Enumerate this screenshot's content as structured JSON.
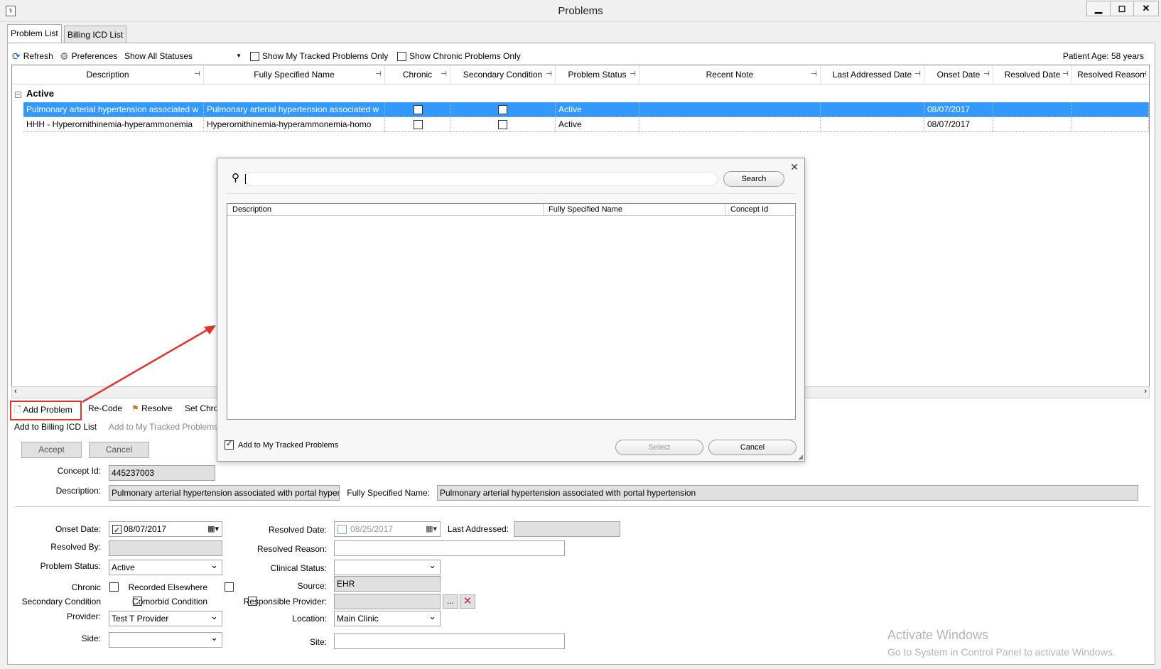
{
  "window": {
    "title": "Problems",
    "minimize": "▁",
    "maximize": "◻",
    "close": "✕"
  },
  "tabs": [
    {
      "label": "Problem List",
      "active": true
    },
    {
      "label": "Billing ICD List",
      "active": false
    }
  ],
  "toolbar": {
    "refresh": "Refresh",
    "preferences": "Preferences",
    "status_filter": "Show All Statuses",
    "tracked_only": "Show My Tracked Problems Only",
    "chronic_only": "Show Chronic Problems Only",
    "patient_age": "Patient Age: 58 years"
  },
  "grid": {
    "columns": [
      "Description",
      "Fully Specified Name",
      "Chronic",
      "Secondary Condition",
      "Problem Status",
      "Recent Note",
      "Last Addressed Date",
      "Onset Date",
      "Resolved Date",
      "Resolved Reason"
    ],
    "group": "Active",
    "rows": [
      {
        "description": "Pulmonary arterial hypertension associated w",
        "fsn": "Pulmonary arterial hypertension associated w",
        "chronic": false,
        "secondary": false,
        "status": "Active",
        "recent_note": "",
        "last_addressed": "",
        "onset": "08/07/2017",
        "resolved": "",
        "reason": "",
        "selected": true
      },
      {
        "description": "HHH - Hyperornithinemia-hyperammonemia",
        "fsn": "Hyperornithinemia-hyperammonemia-homo",
        "chronic": false,
        "secondary": false,
        "status": "Active",
        "recent_note": "",
        "last_addressed": "",
        "onset": "08/07/2017",
        "resolved": "",
        "reason": "",
        "selected": false
      }
    ]
  },
  "actions": {
    "add_problem": "Add Problem",
    "recode": "Re-Code",
    "resolve": "Resolve",
    "set_chronic": "Set Chro",
    "add_billing": "Add to Billing ICD List",
    "add_tracked": "Add to My Tracked Problems"
  },
  "form": {
    "accept": "Accept",
    "cancel": "Cancel",
    "concept_id_label": "Concept Id:",
    "concept_id": "445237003",
    "description_label": "Description:",
    "description": "Pulmonary arterial hypertension associated with portal hyper",
    "fsn_label": "Fully Specified Name:",
    "fsn": "Pulmonary arterial hypertension associated with portal hypertension",
    "onset_label": "Onset Date:",
    "onset": "08/07/2017",
    "resolved_date_label": "Resolved Date:",
    "resolved_date": "08/25/2017",
    "last_addressed_label": "Last Addressed:",
    "resolved_by_label": "Resolved By:",
    "resolved_reason_label": "Resolved Reason:",
    "problem_status_label": "Problem Status:",
    "problem_status": "Active",
    "clinical_status_label": "Clinical Status:",
    "chronic_label": "Chronic",
    "recorded_elsewhere_label": "Recorded Elsewhere",
    "source_label": "Source:",
    "source": "EHR",
    "secondary_label": "Secondary Condition",
    "comorbid_label": "Comorbid Condition",
    "responsible_label": "Responsible Provider:",
    "browse": "...",
    "provider_label": "Provider:",
    "provider": "Test T Provider",
    "location_label": "Location:",
    "location": "Main Clinic",
    "side_label": "Side:",
    "site_label": "Site:"
  },
  "dialog": {
    "search_button": "Search",
    "search_value": "",
    "columns": [
      "Description",
      "Fully Specified Name",
      "Concept Id"
    ],
    "add_tracked": "Add to My Tracked Problems",
    "add_tracked_checked": true,
    "select": "Select",
    "cancel": "Cancel",
    "close": "✕"
  },
  "annotation": {
    "highlight_color": "#e0342c"
  },
  "watermark": {
    "line1": "Activate Windows",
    "line2": "Go to System in Control Panel to activate Windows."
  }
}
